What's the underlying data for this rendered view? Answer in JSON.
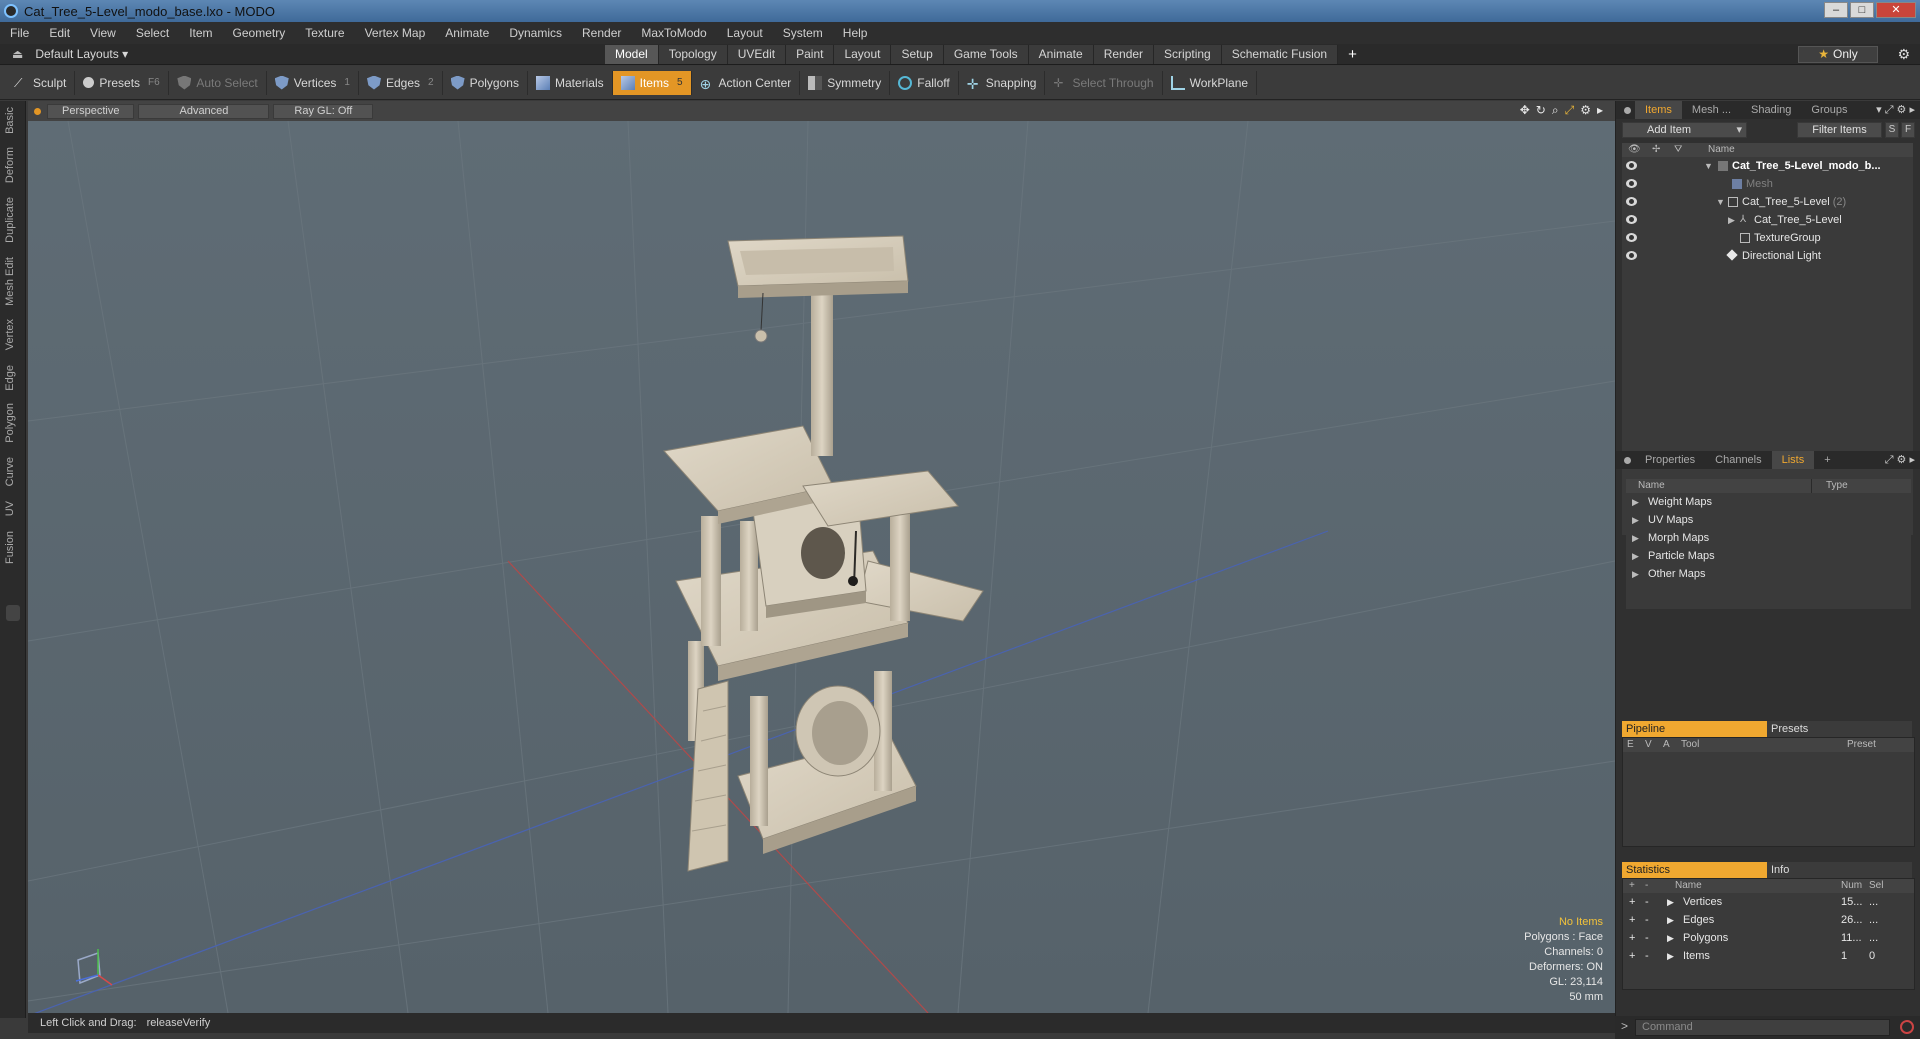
{
  "window": {
    "title": "Cat_Tree_5-Level_modo_base.lxo - MODO",
    "min": "–",
    "max": "□",
    "close": "✕"
  },
  "menu": [
    "File",
    "Edit",
    "View",
    "Select",
    "Item",
    "Geometry",
    "Texture",
    "Vertex Map",
    "Animate",
    "Dynamics",
    "Render",
    "MaxToModo",
    "Layout",
    "System",
    "Help"
  ],
  "layoutbar": {
    "layout_label": "Default Layouts ▾",
    "tabs": [
      "Model",
      "Topology",
      "UVEdit",
      "Paint",
      "Layout",
      "Setup",
      "Game Tools",
      "Animate",
      "Render",
      "Scripting",
      "Schematic Fusion"
    ],
    "active_tab": "Model",
    "plus": "+",
    "only_star": "★",
    "only_label": "Only",
    "gear": "⚙"
  },
  "toolbar": {
    "sculpt": "Sculpt",
    "presets": "Presets",
    "presets_key": "F6",
    "auto_select": "Auto Select",
    "vertices": "Vertices",
    "vertices_num": "1",
    "edges": "Edges",
    "edges_num": "2",
    "polygons": "Polygons",
    "materials": "Materials",
    "items": "Items",
    "items_num": "5",
    "action_center": "Action Center",
    "symmetry": "Symmetry",
    "falloff": "Falloff",
    "snapping": "Snapping",
    "select_through": "Select Through",
    "workplane": "WorkPlane"
  },
  "left_tabs": [
    "Basic",
    "Deform",
    "Duplicate",
    "Mesh Edit",
    "Vertex",
    "Edge",
    "Polygon",
    "Curve",
    "UV",
    "Fusion"
  ],
  "viewport": {
    "view_mode": "Perspective",
    "advanced": "Advanced",
    "raygl": "Ray GL: Off",
    "hud": {
      "no_items": "No Items",
      "polygons": "Polygons : Face",
      "channels": "Channels: 0",
      "deformers": "Deformers: ON",
      "gl": "GL: 23,114",
      "scale": "50 mm"
    }
  },
  "status": {
    "label": "Left Click and Drag:",
    "value": "releaseVerify"
  },
  "items_panel": {
    "tabs": [
      "Items",
      "Mesh ...",
      "Shading",
      "Groups"
    ],
    "active_tab": "Items",
    "add_item": "Add Item",
    "filter_items": "Filter Items",
    "s": "S",
    "f": "F",
    "col_name": "Name",
    "rows": [
      {
        "label": "Cat_Tree_5-Level_modo_b...",
        "style": "bold",
        "count": ""
      },
      {
        "label": "Mesh",
        "style": "dim",
        "count": ""
      },
      {
        "label": "Cat_Tree_5-Level",
        "style": "normal",
        "count": "(2)"
      },
      {
        "label": "Cat_Tree_5-Level",
        "style": "normal",
        "count": ""
      },
      {
        "label": "TextureGroup",
        "style": "normal",
        "count": ""
      },
      {
        "label": "Directional Light",
        "style": "normal",
        "count": ""
      }
    ]
  },
  "props_panel": {
    "tabs": [
      "Properties",
      "Channels",
      "Lists"
    ],
    "active_tab": "Lists",
    "plus": "+",
    "col_name": "Name",
    "col_type": "Type",
    "lists": [
      "Weight Maps",
      "UV Maps",
      "Morph Maps",
      "Particle Maps",
      "Other Maps"
    ]
  },
  "pipeline": {
    "tabs": [
      "Pipeline",
      "Presets"
    ],
    "cols": [
      "E",
      "V",
      "A",
      "Tool",
      "Preset"
    ]
  },
  "statistics": {
    "tabs": [
      "Statistics",
      "Info"
    ],
    "cols": [
      "+",
      "-",
      "Name",
      "Num",
      "Sel"
    ],
    "rows": [
      {
        "name": "Vertices",
        "num": "15...",
        "sel": "..."
      },
      {
        "name": "Edges",
        "num": "26...",
        "sel": "..."
      },
      {
        "name": "Polygons",
        "num": "11...",
        "sel": "..."
      },
      {
        "name": "Items",
        "num": "1",
        "sel": "0"
      }
    ]
  },
  "command": {
    "prompt": ">",
    "placeholder": "Command"
  }
}
